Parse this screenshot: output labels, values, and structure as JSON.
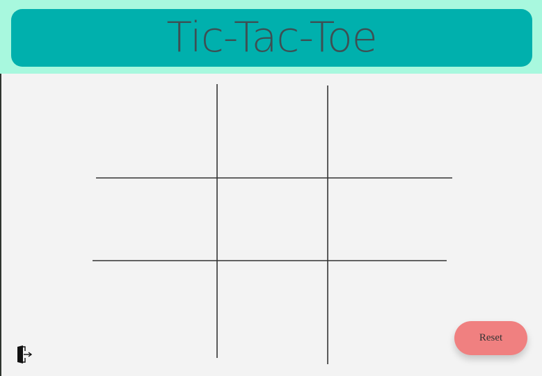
{
  "header": {
    "title": "Tic-Tac-Toe",
    "band_color": "#a8f8de",
    "card_color": "#00b0ad"
  },
  "board": {
    "cells": [
      "",
      "",
      "",
      "",
      "",
      "",
      "",
      "",
      ""
    ]
  },
  "controls": {
    "reset_label": "Reset",
    "reset_color": "#f08080",
    "exit_icon": "exit-door-icon"
  }
}
